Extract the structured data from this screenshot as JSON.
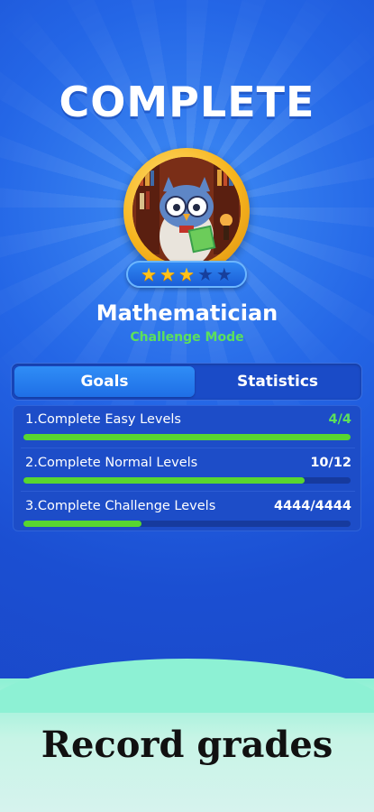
{
  "header": {
    "title": "COMPLETE"
  },
  "achievement": {
    "name": "Mathematician",
    "mode": "Challenge Mode",
    "stars_earned": 3,
    "stars_total": 5
  },
  "tabs": [
    {
      "label": "Goals",
      "active": true
    },
    {
      "label": "Statistics",
      "active": false
    }
  ],
  "goals": [
    {
      "label": "1.Complete Easy Levels",
      "value": "4/4",
      "progress": 1.0,
      "done": true
    },
    {
      "label": "2.Complete Normal Levels",
      "value": "10/12",
      "progress": 0.86,
      "done": false
    },
    {
      "label": "3.Complete Challenge Levels",
      "value": "4444/4444",
      "progress": 0.36,
      "done": false
    }
  ],
  "footer": {
    "caption": "Record grades"
  },
  "colors": {
    "background": "#1a4fd6",
    "progress_fill": "#58d630",
    "mode_text": "#5ce05c",
    "star_on": "#ffc21a",
    "star_off": "#173f9c"
  },
  "icons": [
    "owl-scholar-avatar",
    "star-icon"
  ]
}
